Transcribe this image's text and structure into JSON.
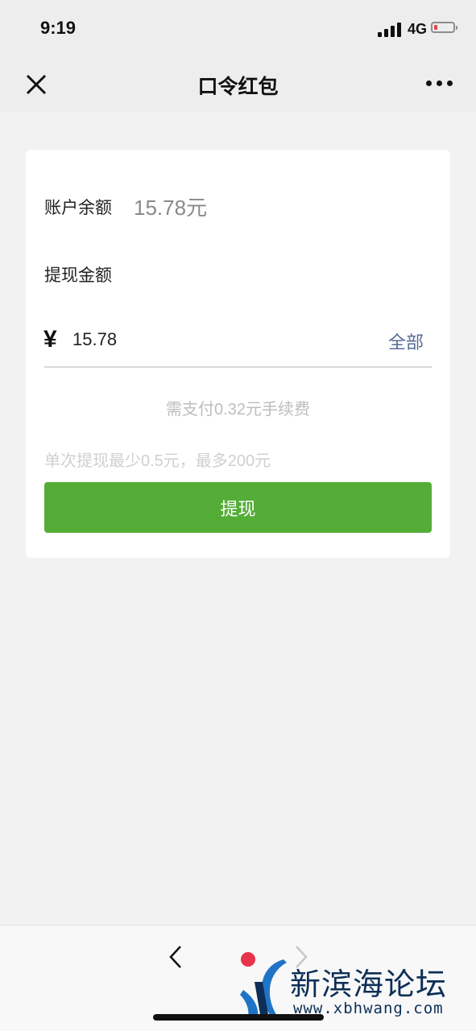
{
  "status_bar": {
    "time": "9:19",
    "network": "4G"
  },
  "nav": {
    "title": "口令红包",
    "close_icon": "close-icon",
    "more_icon": "more-dots-icon"
  },
  "card": {
    "balance_label": "账户余额",
    "balance_value": "15.78元",
    "amount_label": "提现金额",
    "currency_symbol": "¥",
    "amount_value": "15.78",
    "all_label": "全部",
    "fee_text": "需支付0.32元手续费",
    "limit_text": "单次提现最少0.5元，最多200元",
    "withdraw_label": "提现"
  },
  "bottom_bar": {
    "back_icon": "chevron-left-icon",
    "forward_icon": "chevron-right-icon"
  },
  "watermark": {
    "name": "新滨海论坛",
    "url": "www.xbhwang.com"
  },
  "colors": {
    "primary_green": "#54ad37",
    "link_blue": "#576b95",
    "page_bg": "#f2f2f2"
  }
}
